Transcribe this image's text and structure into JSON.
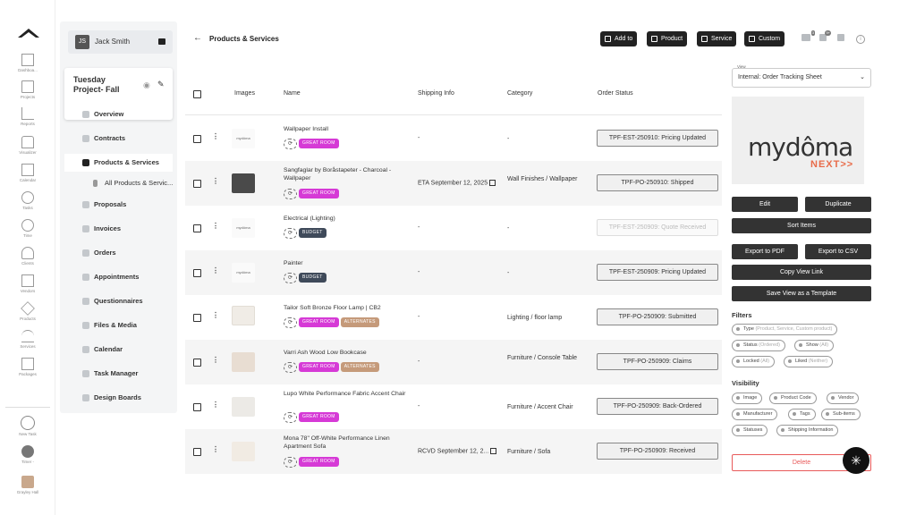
{
  "rail": {
    "items": [
      {
        "label": "Dashboa..."
      },
      {
        "label": "Projects"
      },
      {
        "label": "Reports"
      },
      {
        "label": "Visualizer"
      },
      {
        "label": "Calendar"
      },
      {
        "label": "Tasks"
      },
      {
        "label": "Time"
      },
      {
        "label": "Clients"
      },
      {
        "label": "Vendors"
      },
      {
        "label": "Products"
      },
      {
        "label": "Services"
      },
      {
        "label": "Packages"
      },
      {
        "label": "New Task"
      },
      {
        "label": "Timer -"
      },
      {
        "label": "Grayley Hall"
      }
    ]
  },
  "user": {
    "initials": "JS",
    "name": "Jack Smith"
  },
  "project": {
    "title": "Tuesday Project- Fall"
  },
  "nav": {
    "items": [
      {
        "label": "Overview"
      },
      {
        "label": "Contracts"
      },
      {
        "label": "Products & Services"
      },
      {
        "label": "All Products & Servic..."
      },
      {
        "label": "Proposals"
      },
      {
        "label": "Invoices"
      },
      {
        "label": "Orders"
      },
      {
        "label": "Appointments"
      },
      {
        "label": "Questionnaires"
      },
      {
        "label": "Files & Media"
      },
      {
        "label": "Calendar"
      },
      {
        "label": "Task Manager"
      },
      {
        "label": "Design Boards"
      }
    ]
  },
  "topbar": {
    "back": "←",
    "title": "Products & Services",
    "buttons": [
      "Add to",
      "Product",
      "Service",
      "Custom"
    ],
    "badges": [
      "3",
      "9+",
      ""
    ],
    "help": "i"
  },
  "table": {
    "headers": {
      "images": "Images",
      "name": "Name",
      "shipping": "Shipping Info",
      "category": "Category",
      "status": "Order Status"
    },
    "rows": [
      {
        "name": "Wallpaper Install",
        "tags": [
          "GREAT ROOM"
        ],
        "shipping": "-",
        "category": "-",
        "status": "TPF-EST-250910: Pricing Updated"
      },
      {
        "name": "Sangfaglar by Boråstapeter - Charcoal - Wallpaper",
        "tags": [
          "GREAT ROOM"
        ],
        "shipping": "ETA September 12, 2025",
        "category": "Wall Finishes / Wallpaper",
        "status": "TPF-PO-250910: Shipped"
      },
      {
        "name": "Electrical (Lighting)",
        "tags": [
          "BUDGET"
        ],
        "shipping": "-",
        "category": "-",
        "status": "TPF-EST-250909: Quote Received"
      },
      {
        "name": "Painter",
        "tags": [
          "BUDGET"
        ],
        "shipping": "-",
        "category": "-",
        "status": "TPF-EST-250909: Pricing Updated"
      },
      {
        "name": "Tailor Soft Bronze Floor Lamp | CB2",
        "tags": [
          "GREAT ROOM",
          "ALTERNATES"
        ],
        "shipping": "-",
        "category": "Lighting / floor lamp",
        "status": "TPF-PO-250909: Submitted"
      },
      {
        "name": "Varri Ash Wood Low Bookcase",
        "tags": [
          "GREAT ROOM",
          "ALTERNATES"
        ],
        "shipping": "-",
        "category": "Furniture / Console Table",
        "status": "TPF-PO-250909: Claims"
      },
      {
        "name": "Lupo White Performance Fabric Accent Chair",
        "tags": [
          "GREAT ROOM"
        ],
        "shipping": "-",
        "category": "Furniture / Accent Chair",
        "status": "TPF-PO-250909: Back-Ordered"
      },
      {
        "name": "Mona 78\" Off-White Performance Linen Apartment Sofa",
        "tags": [
          "GREAT ROOM"
        ],
        "shipping": "RCVD September 12, 2...",
        "category": "Furniture / Sofa",
        "status": "TPF-PO-250909: Received"
      }
    ],
    "logo_thumb": "mydôma"
  },
  "panel": {
    "view_label": "View",
    "view_value": "Internal: Order Tracking Sheet",
    "logo_main": "mydôma",
    "logo_sub": "NEXT>>",
    "buttons": {
      "edit": "Edit",
      "duplicate": "Duplicate",
      "sort": "Sort Items",
      "export_pdf": "Export to PDF",
      "export_csv": "Export to CSV",
      "copy_link": "Copy View Link",
      "save_template": "Save View as a Template",
      "delete": "Delete"
    },
    "filters_title": "Filters",
    "filters": [
      {
        "label": "Type",
        "value": "(Product, Service, Custom product)"
      },
      {
        "label": "Status",
        "value": "(Ordered)"
      },
      {
        "label": "Show",
        "value": "(All)"
      },
      {
        "label": "Locked",
        "value": "(All)"
      },
      {
        "label": "Liked",
        "value": "(Neither)"
      }
    ],
    "visibility_title": "Visibility",
    "visibility": [
      "Image",
      "Product Code",
      "Vendor",
      "Manufacturer",
      "Tags",
      "Sub-items",
      "Statuses",
      "Shipping Information"
    ]
  },
  "colors": {
    "pink_tag": "#d63ad6",
    "budget_tag": "#3f4a5a",
    "alt_tag": "#c59a7a",
    "delete": "#e85a5a",
    "logo_accent": "#e86c4a"
  }
}
